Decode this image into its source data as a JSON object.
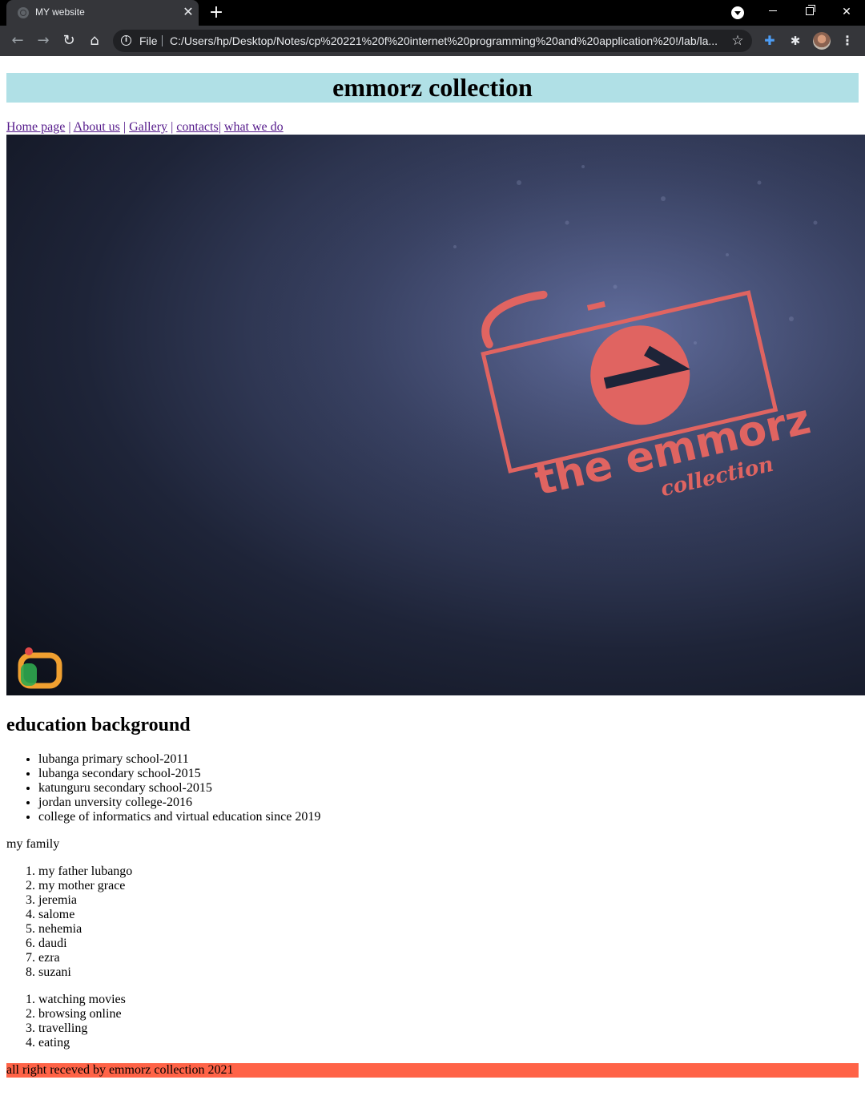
{
  "browser": {
    "tab_title": "MY website",
    "tab_close": "✕",
    "new_tab": "+",
    "scheme_label": "File",
    "url": "C:/Users/hp/Desktop/Notes/cp%20221%20f%20internet%20programming%20and%20application%20!/lab/la...",
    "icons": [
      "back-arrow-icon",
      "forward-arrow-icon",
      "reload-icon",
      "home-icon",
      "info-icon",
      "star-icon",
      "extension-icon",
      "puzzle-icon",
      "avatar",
      "menu-icon"
    ]
  },
  "site": {
    "title": "emmorz collection",
    "header_bg": "#b0e0e6"
  },
  "nav": {
    "items": [
      {
        "label": "Home page"
      },
      {
        "label": "About us"
      },
      {
        "label": "Gallery"
      },
      {
        "label": "contacts"
      },
      {
        "label": "what we do"
      }
    ]
  },
  "hero": {
    "logo_text": "the emmorz",
    "logo_subtext": "collection",
    "logo_letter": "e",
    "logo_color": "#e06461"
  },
  "education": {
    "heading": "education background",
    "items": [
      "lubanga primary school-2011",
      "lubanga secondary school-2015",
      "katunguru secondary school-2015",
      "jordan unversity college-2016",
      "college of informatics and virtual education since 2019"
    ]
  },
  "family": {
    "label": "my family",
    "members": [
      "my father lubango",
      "my mother grace",
      "jeremia",
      "salome",
      "nehemia",
      "daudi",
      "ezra",
      "suzani"
    ]
  },
  "hobbies": {
    "items": [
      "watching movies",
      "browsing online",
      "travelling",
      "eating"
    ]
  },
  "footer": {
    "text": "all right receved by emmorz collection 2021",
    "bg": "#ff6347"
  }
}
